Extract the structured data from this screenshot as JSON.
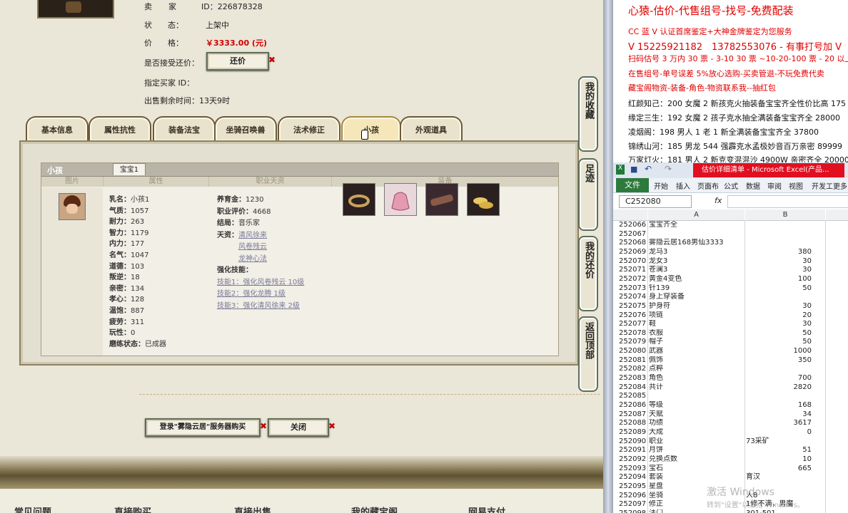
{
  "seller": {
    "label": "卖　家",
    "id_label": "ID：",
    "id": "226878328"
  },
  "status": {
    "label": "状　　态：",
    "value": "上架中"
  },
  "price": {
    "label": "价　　格：",
    "value": "￥3333.00 (元)"
  },
  "bargain": {
    "label": "是否接受还价：",
    "button": "还价",
    "close_mark": "✖"
  },
  "buyer": {
    "label": "指定买家 ID：",
    "value": ""
  },
  "remaining": {
    "label": "出售剩余时间：",
    "value": "13天9时"
  },
  "tabs": [
    {
      "label": "基本信息"
    },
    {
      "label": "属性抗性"
    },
    {
      "label": "装备法宝"
    },
    {
      "label": "坐骑召唤兽"
    },
    {
      "label": "法术修正"
    },
    {
      "label": "小孩"
    },
    {
      "label": "外观道具"
    }
  ],
  "child_panel": {
    "title": "小孩",
    "subtab": "宝宝1",
    "columns": [
      "图片",
      "属性",
      "职业天资",
      "装备"
    ],
    "attributes": [
      {
        "k": "乳名：",
        "v": "小孩1"
      },
      {
        "k": "气质：",
        "v": "1057"
      },
      {
        "k": "耐力：",
        "v": "263"
      },
      {
        "k": "智力：",
        "v": "1179"
      },
      {
        "k": "内力：",
        "v": "177"
      },
      {
        "k": "名气：",
        "v": "1047"
      },
      {
        "k": "道德：",
        "v": "103"
      },
      {
        "k": "叛逆：",
        "v": "18"
      },
      {
        "k": "亲密：",
        "v": "134"
      },
      {
        "k": "孝心：",
        "v": "128"
      },
      {
        "k": "温饱：",
        "v": "887"
      },
      {
        "k": "疲劳：",
        "v": "311"
      },
      {
        "k": "玩性：",
        "v": "0"
      },
      {
        "k": "磨练状态：",
        "v": "已成器"
      }
    ],
    "career": {
      "funds": {
        "k": "养育金：",
        "v": "1230"
      },
      "rating": {
        "k": "职业评价：",
        "v": "4668"
      },
      "ending": {
        "k": "结局：",
        "v": "音乐家"
      },
      "talent_label": "天资：",
      "talents": [
        "清风徐来",
        "风卷残云",
        "龙神心法"
      ],
      "skills_label": "强化技能：",
      "skills": [
        "技能1：强化风卷残云 10级",
        "技能2：强化龙腾 1级",
        "技能3：强化清风徐来 2级"
      ]
    },
    "equipment_icons": [
      "ring-icon",
      "pouch-icon",
      "scroll-icon",
      "shoes-icon"
    ]
  },
  "side_buttons": [
    {
      "label": "我的收藏"
    },
    {
      "label": "足迹"
    },
    {
      "label": "我的还价"
    },
    {
      "label": "返回顶部"
    }
  ],
  "bottom_buttons": {
    "login": "登录\"雾隐云居\"服务器购买",
    "close": "关闭"
  },
  "footer_links": [
    "常见问题",
    "直接购买",
    "直接出售",
    "我的藏宝阁",
    "网易支付"
  ],
  "ad": {
    "title": "心猿-估价-代售组号-找号-免费配装",
    "lines": [
      {
        "text": "CC 蓝 V 认证首席鉴定+大神金牌鉴定为您服务",
        "color": "#e00000"
      },
      {
        "text": "V 15225921182　13782553076 - 有事打号加 V",
        "color": "#e00000"
      },
      {
        "text": "扫码估号 3 万内 30 票 - 3-10 30 票 ~10-20-100 票 - 20 以上 150",
        "color": "#e00000"
      },
      {
        "text": "在售组号-单号误差 5%放心选购-买卖管退-不玩免费代卖",
        "color": "#e00000"
      },
      {
        "text": "藏宝阁物资-装备-角色-物资联系我--抽红包",
        "color": "#e00000"
      },
      {
        "text": "红颜知己：200 女魔 2 新孩克火抽装备宝宝齐全性价比高 175",
        "color": "#111111"
      },
      {
        "text": "缘定三生：192 女魔 2 孩子克水抽全满装备宝宝齐全 28000",
        "color": "#111111"
      },
      {
        "text": "凌烟阁：198 男人 1 老 1 新全满装备宝宝齐全 37800",
        "color": "#111111"
      },
      {
        "text": "锦绣山河：185 男龙 544 强霹克水孟极妙音百万亲密 89999",
        "color": "#111111"
      },
      {
        "text": "万家灯火：181 男人 2 新克变混混沙 4900W 亲密齐全 20000",
        "color": "#111111"
      }
    ]
  },
  "excel": {
    "window_title": "估价详细清单 - Microsoft Excel(产品...",
    "ribbon_tabs": [
      "文件",
      "开始",
      "插入",
      "页面布",
      "公式",
      "数据",
      "审阅",
      "视图",
      "开发工",
      "更多"
    ],
    "name_box": "C252080",
    "fx": "fx",
    "col_a": "A",
    "col_b": "B",
    "rows": [
      {
        "n": "252066",
        "a": "宝宝齐全",
        "b": ""
      },
      {
        "n": "252067",
        "a": "",
        "b": ""
      },
      {
        "n": "252068",
        "a": "雾隐云居168男仙3333",
        "b": ""
      },
      {
        "n": "252069",
        "a": "龙马3",
        "b": "380"
      },
      {
        "n": "252070",
        "a": "龙女3",
        "b": "30"
      },
      {
        "n": "252071",
        "a": "苍澜3",
        "b": "30"
      },
      {
        "n": "252072",
        "a": "黄金4变色",
        "b": "100"
      },
      {
        "n": "252073",
        "a": "针139",
        "b": "50"
      },
      {
        "n": "252074",
        "a": "身上穿装备",
        "b": ""
      },
      {
        "n": "252075",
        "a": "护身符",
        "b": "30"
      },
      {
        "n": "252076",
        "a": "项链",
        "b": "20"
      },
      {
        "n": "252077",
        "a": "鞋",
        "b": "30"
      },
      {
        "n": "252078",
        "a": "衣服",
        "b": "50"
      },
      {
        "n": "252079",
        "a": "帽子",
        "b": "50"
      },
      {
        "n": "252080",
        "a": "武器",
        "b": "1000"
      },
      {
        "n": "252081",
        "a": "佩饰",
        "b": "350"
      },
      {
        "n": "252082",
        "a": "点粹",
        "b": ""
      },
      {
        "n": "252083",
        "a": "角色",
        "b": "700"
      },
      {
        "n": "252084",
        "a": "共计",
        "b": "2820"
      },
      {
        "n": "252085",
        "a": "",
        "b": ""
      },
      {
        "n": "252086",
        "a": "等级",
        "b": "168"
      },
      {
        "n": "252087",
        "a": "天赋",
        "b": "34"
      },
      {
        "n": "252088",
        "a": "功绩",
        "b": "3617"
      },
      {
        "n": "252089",
        "a": "大成",
        "b": "0"
      },
      {
        "n": "252090",
        "a": "职业",
        "b": "",
        "bl": "73采矿"
      },
      {
        "n": "252091",
        "a": "月饼",
        "b": "51"
      },
      {
        "n": "252092",
        "a": "兑换点数",
        "b": "10"
      },
      {
        "n": "252093",
        "a": "宝石",
        "b": "665"
      },
      {
        "n": "252094",
        "a": "套装",
        "b": "",
        "bl": "育汉"
      },
      {
        "n": "252095",
        "a": "星盘",
        "b": ""
      },
      {
        "n": "252096",
        "a": "坐骑",
        "b": "",
        "bl": "人8"
      },
      {
        "n": "252097",
        "a": "修正",
        "b": "",
        "bl": "1修不满，男魔"
      },
      {
        "n": "252098",
        "a": "法门",
        "b": "",
        "bl": "301-501"
      }
    ]
  },
  "watermark": {
    "line1": "激活 Windows",
    "line2": "转到\"设置\"以激活 Windows。"
  }
}
